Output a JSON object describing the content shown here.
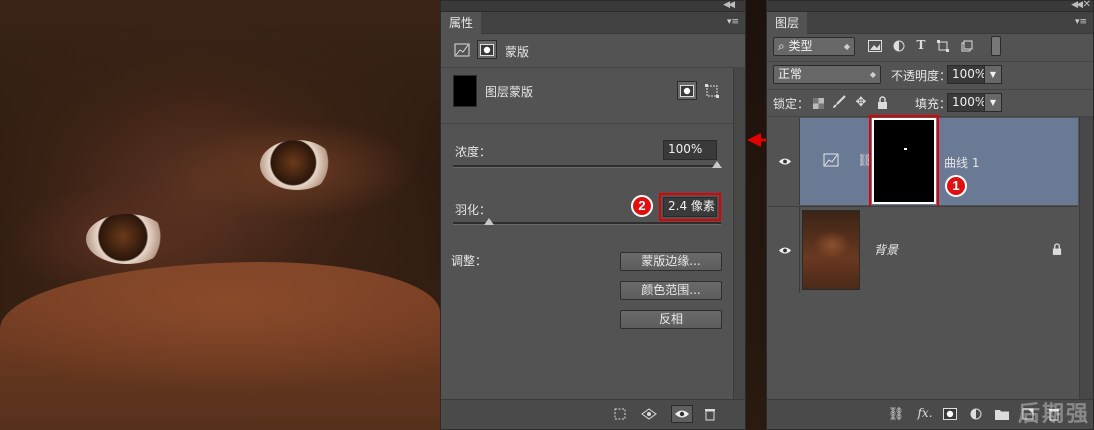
{
  "properties": {
    "title": "属性",
    "panel_type": "蒙版",
    "mask_label": "图层蒙版",
    "density_label": "浓度：",
    "density_value": "100%",
    "density_fraction": 1.0,
    "feather_label": "羽化：",
    "feather_value": "2.4 像素",
    "feather_fraction": 0.13,
    "refine_label": "调整：",
    "btn_mask_edge": "蒙版边缘...",
    "btn_color_range": "颜色范围...",
    "btn_invert": "反相"
  },
  "layers": {
    "title": "图层",
    "filter_kind": "类型",
    "blend_mode": "正常",
    "opacity_label": "不透明度：",
    "opacity_value": "100%",
    "lock_label": "锁定：",
    "fill_label": "填充：",
    "fill_value": "100%",
    "items": [
      {
        "name": "曲线 1",
        "selected": true
      },
      {
        "name": "背景",
        "selected": false
      }
    ]
  },
  "annotations": {
    "badge1": "1",
    "badge2": "2",
    "highlight_color": "#e30000"
  },
  "watermark": "后期强"
}
